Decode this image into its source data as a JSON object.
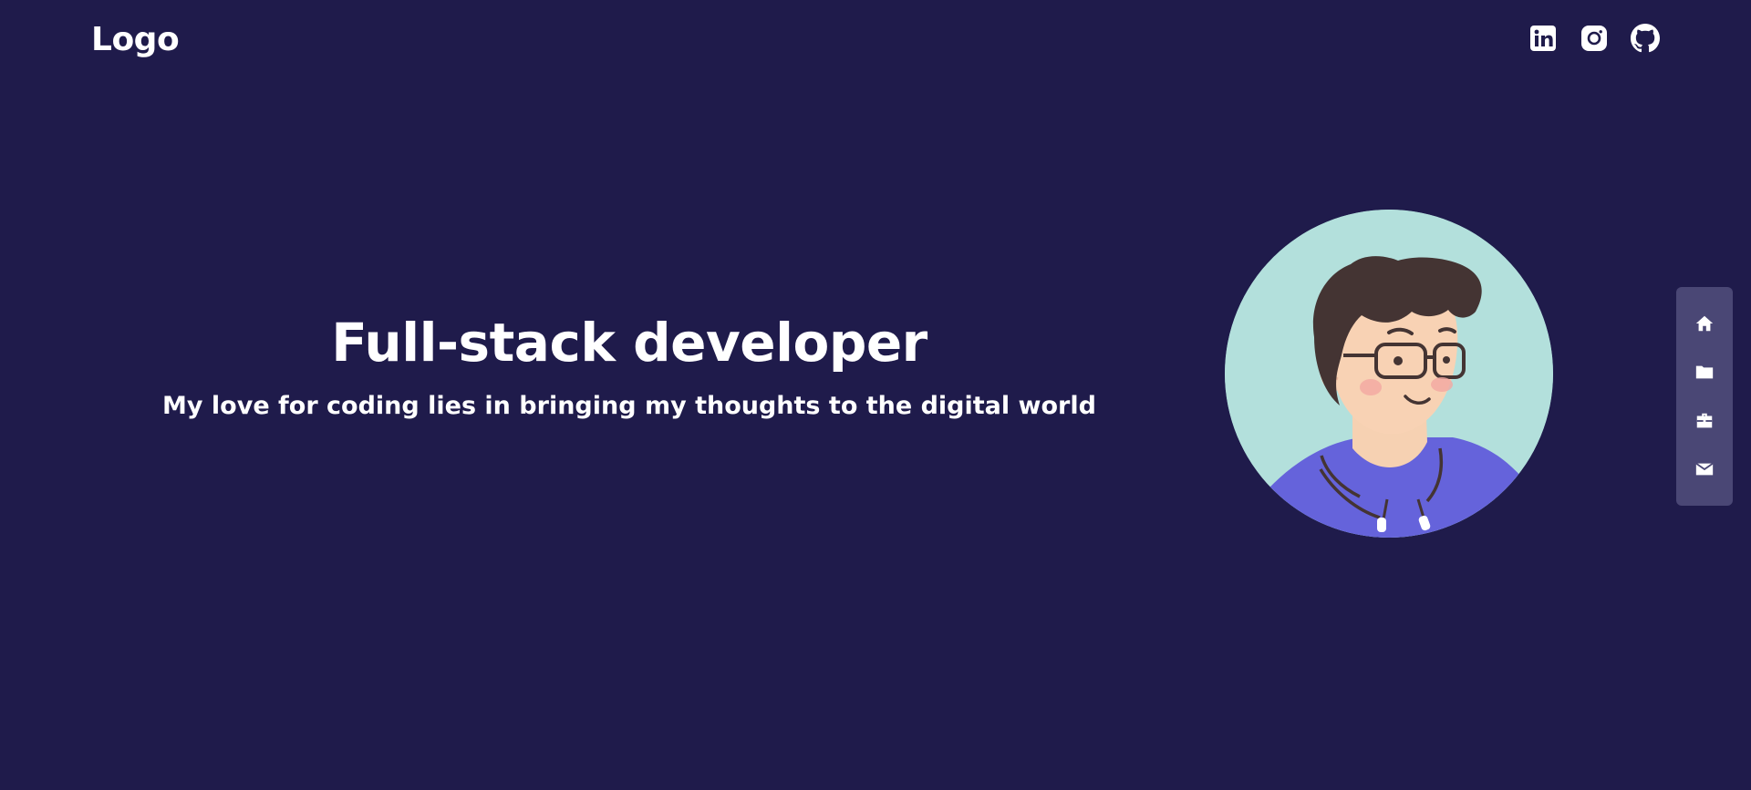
{
  "header": {
    "logo_text": "Logo",
    "socials": [
      {
        "icon": "linkedin-icon"
      },
      {
        "icon": "instagram-icon"
      },
      {
        "icon": "github-icon"
      }
    ]
  },
  "hero": {
    "title": "Full-stack developer",
    "subtitle": "My love for coding lies in bringing my thoughts to the digital world"
  },
  "side_nav": {
    "items": [
      {
        "icon": "home-icon"
      },
      {
        "icon": "folder-icon"
      },
      {
        "icon": "briefcase-icon"
      },
      {
        "icon": "mail-icon"
      }
    ]
  },
  "colors": {
    "background": "#1f1b4b",
    "text": "#ffffff",
    "side_nav_background": "#4a4775",
    "avatar_background": "#b3e0dc",
    "hoodie": "#6563db",
    "hair": "#443433",
    "skin": "#f8d2b4"
  }
}
